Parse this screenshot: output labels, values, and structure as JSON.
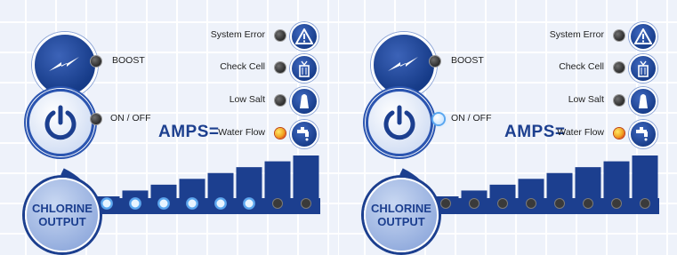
{
  "panels": [
    {
      "boost_label": "BOOST",
      "onoff_label": "ON / OFF",
      "boost_led": "off",
      "onoff_led": "off",
      "status": [
        {
          "label": "System Error",
          "led": "off",
          "icon": "warning-icon"
        },
        {
          "label": "Check Cell",
          "led": "off",
          "icon": "cell-icon"
        },
        {
          "label": "Low Salt",
          "led": "off",
          "icon": "salt-shaker-icon"
        },
        {
          "label": "Water Flow",
          "led": "orange",
          "icon": "water-tap-icon"
        }
      ],
      "amps_label": "AMPS=",
      "chlorine_label_line1": "CHLORINE",
      "chlorine_label_line2": "OUTPUT",
      "output_level": 6,
      "output_max": 8
    },
    {
      "boost_label": "BOOST",
      "onoff_label": "ON / OFF",
      "boost_led": "off",
      "onoff_led": "blue",
      "status": [
        {
          "label": "System Error",
          "led": "off",
          "icon": "warning-icon"
        },
        {
          "label": "Check Cell",
          "led": "off",
          "icon": "cell-icon"
        },
        {
          "label": "Low Salt",
          "led": "off",
          "icon": "salt-shaker-icon"
        },
        {
          "label": "Water Flow",
          "led": "orange",
          "icon": "water-tap-icon"
        }
      ],
      "amps_label": "AMPS=",
      "chlorine_label_line1": "CHLORINE",
      "chlorine_label_line2": "OUTPUT",
      "output_level": 0,
      "output_max": 8
    }
  ],
  "colors": {
    "brand_blue": "#1c3f8f",
    "led_active_blue": "#5aa7f0",
    "led_alert_orange": "#f0a020"
  }
}
